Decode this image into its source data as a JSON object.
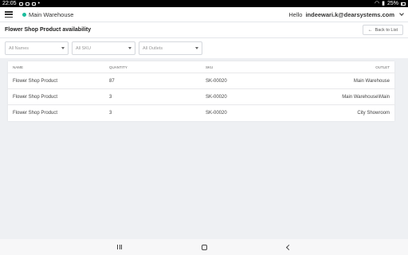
{
  "status_bar": {
    "time": "22:05",
    "battery": "25%",
    "icons": [
      "image-icon",
      "image-icon",
      "mail-icon",
      "dot-icon",
      "wifi-icon",
      "signal-icon",
      "battery-icon"
    ]
  },
  "topbar": {
    "warehouse": "Main Warehouse",
    "warehouse_color": "#1abc9c",
    "greeting": "Hello",
    "user_email": "indeewari.k@dearsystems.com"
  },
  "header": {
    "title": "Flower Shop Product  availability",
    "back_label": "Back to List"
  },
  "filters": {
    "names_placeholder": "All Names",
    "sku_placeholder": "All SKU",
    "outlets_placeholder": "All Outlets"
  },
  "table": {
    "columns": [
      "NAME",
      "QUANTITY",
      "SKU",
      "OUTLET"
    ],
    "rows": [
      {
        "name": "Flower Shop Product",
        "quantity": "87",
        "sku": "SK-00020",
        "outlet": "Main Warehouse"
      },
      {
        "name": "Flower Shop Product",
        "quantity": "3",
        "sku": "SK-00020",
        "outlet": "Main Warehouse\\Main"
      },
      {
        "name": "Flower Shop Product",
        "quantity": "3",
        "sku": "SK-00020",
        "outlet": "City Showroom"
      }
    ]
  }
}
